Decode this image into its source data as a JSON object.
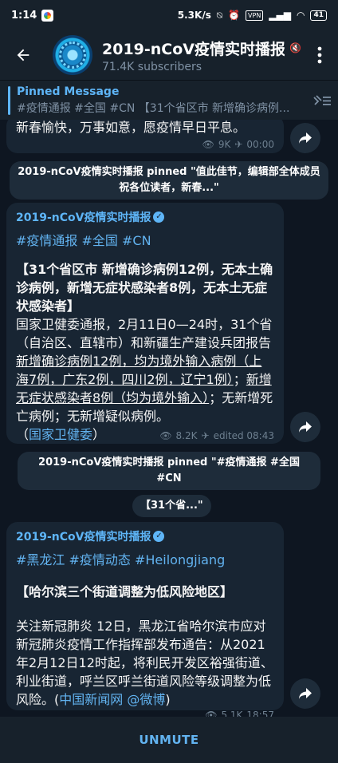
{
  "status_bar": {
    "time": "1:14",
    "network_speed": "5.3K/s",
    "vpn": "VPN",
    "signal": "4G",
    "battery": "41"
  },
  "header": {
    "title": "2019-nCoV疫情实时播报...",
    "subscribers": "71.4K subscribers"
  },
  "pinned": {
    "label": "Pinned Message",
    "content": "#疫情通报 #全国 #CN 【31个省区市 新增确诊病例..."
  },
  "messages": [
    {
      "text": "新春愉快，万事如意，愿疫情早日平息。",
      "views": "9K",
      "time": "00:00"
    },
    {
      "service": "2019-nCoV疫情实时播报 pinned \"值此佳节，编辑部全体成员祝各位读者，新春...\""
    },
    {
      "author": "2019-nCoV疫情实时播报",
      "hashtags": "#疫情通报 #全国 #CN",
      "headline": "【31个省区市 新增确诊病例12例，无本土确诊病例，新增无症状感染者8例，无本土无症状感染者】",
      "body_plain_1": "国家卫健委通报，2月11日0—24时，31个省（自治区、直辖市）和新疆生产建设兵团报告",
      "body_underline_1": "新增确诊病例12例，均为境外输入病例（上海7例，广东2例，四川2例，辽宁1例）",
      "body_plain_2": "；",
      "body_underline_2": "新增无症状感染者8例（均为境外输入）",
      "body_plain_3": "；无新增死亡病例；无新增疑似病例。",
      "source_open": "（",
      "source_link": "国家卫健委",
      "source_close": "）",
      "views": "8.2K",
      "time": "edited 08:43"
    },
    {
      "service": "2019-nCoV疫情实时播报 pinned \"#疫情通报 #全国 #CN"
    },
    {
      "service": "【31个省...\""
    },
    {
      "author": "2019-nCoV疫情实时播报",
      "hashtags": "#黑龙江 #疫情动态 #Heilongjiang",
      "headline": "【哈尔滨三个街道调整为低风险地区】",
      "body": "关注新冠肺炎 12日，黑龙江省哈尔滨市应对新冠肺炎疫情工作指挥部发布通告：从2021年2月12日12时起，将利民开发区裕强街道、利业街道，呼兰区呼兰街道风险等级调整为低风险。(",
      "source_link": "中国新闻网 @微博",
      "source_close": ")",
      "views": "5.1K",
      "time": "18:57"
    }
  ],
  "footer": {
    "unmute_label": "UNMUTE"
  },
  "icons": {
    "back": "back-arrow-icon",
    "menu": "more-vertical-icon",
    "pinned_list": "pinned-list-icon",
    "share": "share-arrow-icon",
    "views": "eye-icon",
    "edited": "pin-icon"
  }
}
